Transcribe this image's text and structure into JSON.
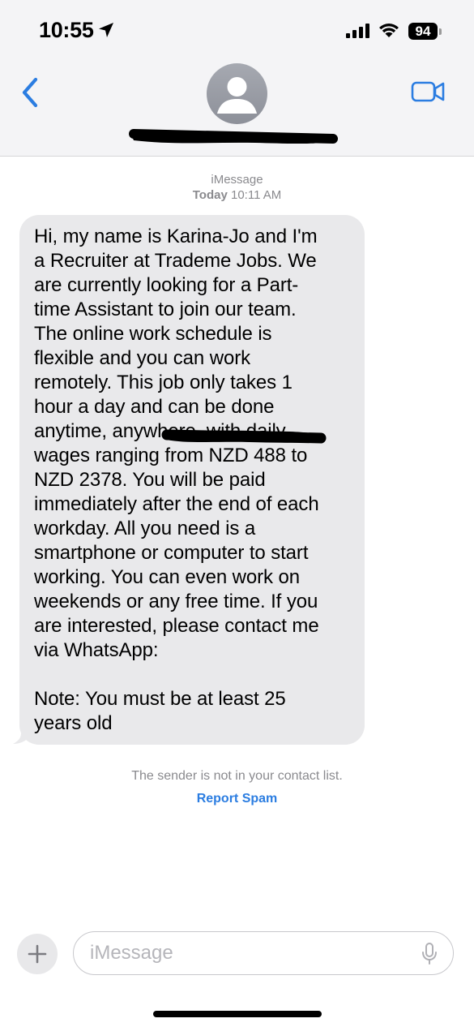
{
  "status_bar": {
    "time": "10:55",
    "battery": "94"
  },
  "thread": {
    "service": "iMessage",
    "day": "Today",
    "time": "10:11 AM"
  },
  "message": {
    "lines": [
      "Hi, my name is Karina-Jo and I'm",
      "a Recruiter at Trademe Jobs. We",
      "are currently looking for a Part-",
      "time Assistant to join our team.",
      "The online work schedule is",
      "flexible and you can work",
      "remotely. This job only takes 1",
      "hour a day and can be done",
      "anytime, anywhere, with daily",
      "wages ranging from NZD 488 to",
      "NZD 2378. You will be paid",
      "immediately after the end of each",
      "workday. All you need is a",
      "smartphone or computer to start",
      "working. You can even work on",
      "weekends or any free time. If you",
      "are interested, please contact me",
      "via WhatsApp:",
      "",
      "Note: You must be at least 25",
      "years old"
    ]
  },
  "notice": {
    "text": "The sender is not in your contact list.",
    "action": "Report Spam"
  },
  "composer": {
    "placeholder": "iMessage"
  },
  "colors": {
    "accent": "#2b7de1",
    "bubble": "#e9e9eb",
    "header_bg": "#f4f4f6",
    "secondary_text": "#8a8a8e"
  }
}
